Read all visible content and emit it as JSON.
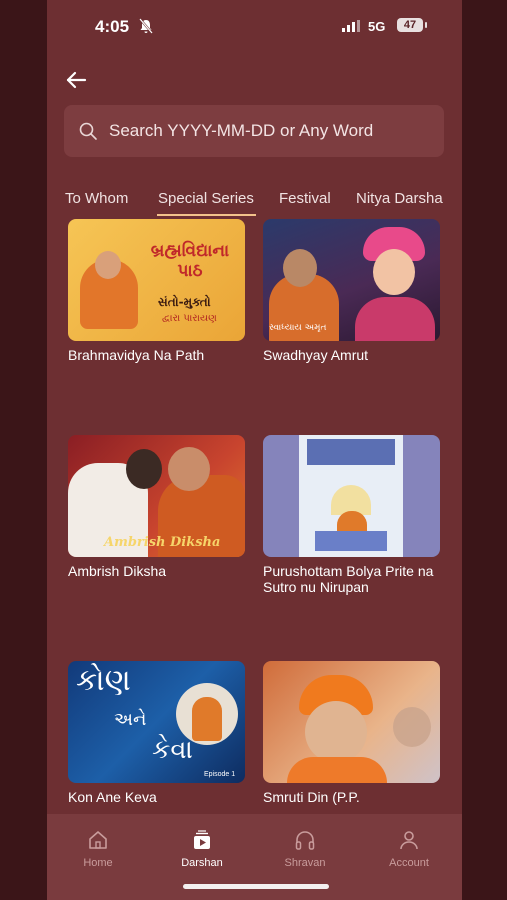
{
  "status": {
    "time": "4:05",
    "network": "5G",
    "battery": "47"
  },
  "search": {
    "placeholder": "Search YYYY-MM-DD or Any Word"
  },
  "tabs": [
    {
      "label": "To Whom"
    },
    {
      "label": "Special Series",
      "active": true
    },
    {
      "label": "Festival"
    },
    {
      "label": "Nitya Darsha"
    }
  ],
  "cards": [
    {
      "title": "Brahmavidya Na Path",
      "thumb_text_1": "બ્રહ્મવિદ્યાના પાઠ",
      "thumb_text_2": "સંતો-મુક્તો",
      "thumb_text_3": "દ્વારા પારાયણ"
    },
    {
      "title": "Swadhyay Amrut",
      "thumb_text_1": "સ્વાધ્યાય અમૃત"
    },
    {
      "title": "Ambrish Diksha",
      "thumb_text_1": "Ambrish Diksha"
    },
    {
      "title": "Purushottam Bolya Prite na Sutro nu Nirupan"
    },
    {
      "title": "Kon Ane Keva",
      "thumb_text_1": "કોણ",
      "thumb_text_2": "અને",
      "thumb_text_3": "કેવા",
      "thumb_text_4": "Episode 1"
    },
    {
      "title": "Smruti Din (P.P."
    }
  ],
  "nav": {
    "items": [
      {
        "label": "Home",
        "icon": "home-icon"
      },
      {
        "label": "Darshan",
        "icon": "play-icon",
        "active": true
      },
      {
        "label": "Shravan",
        "icon": "headphones-icon"
      },
      {
        "label": "Account",
        "icon": "person-icon"
      }
    ]
  },
  "colors": {
    "background": "#6d2f32",
    "accent": "#f3c28c",
    "nav": "#7a3b3e"
  }
}
